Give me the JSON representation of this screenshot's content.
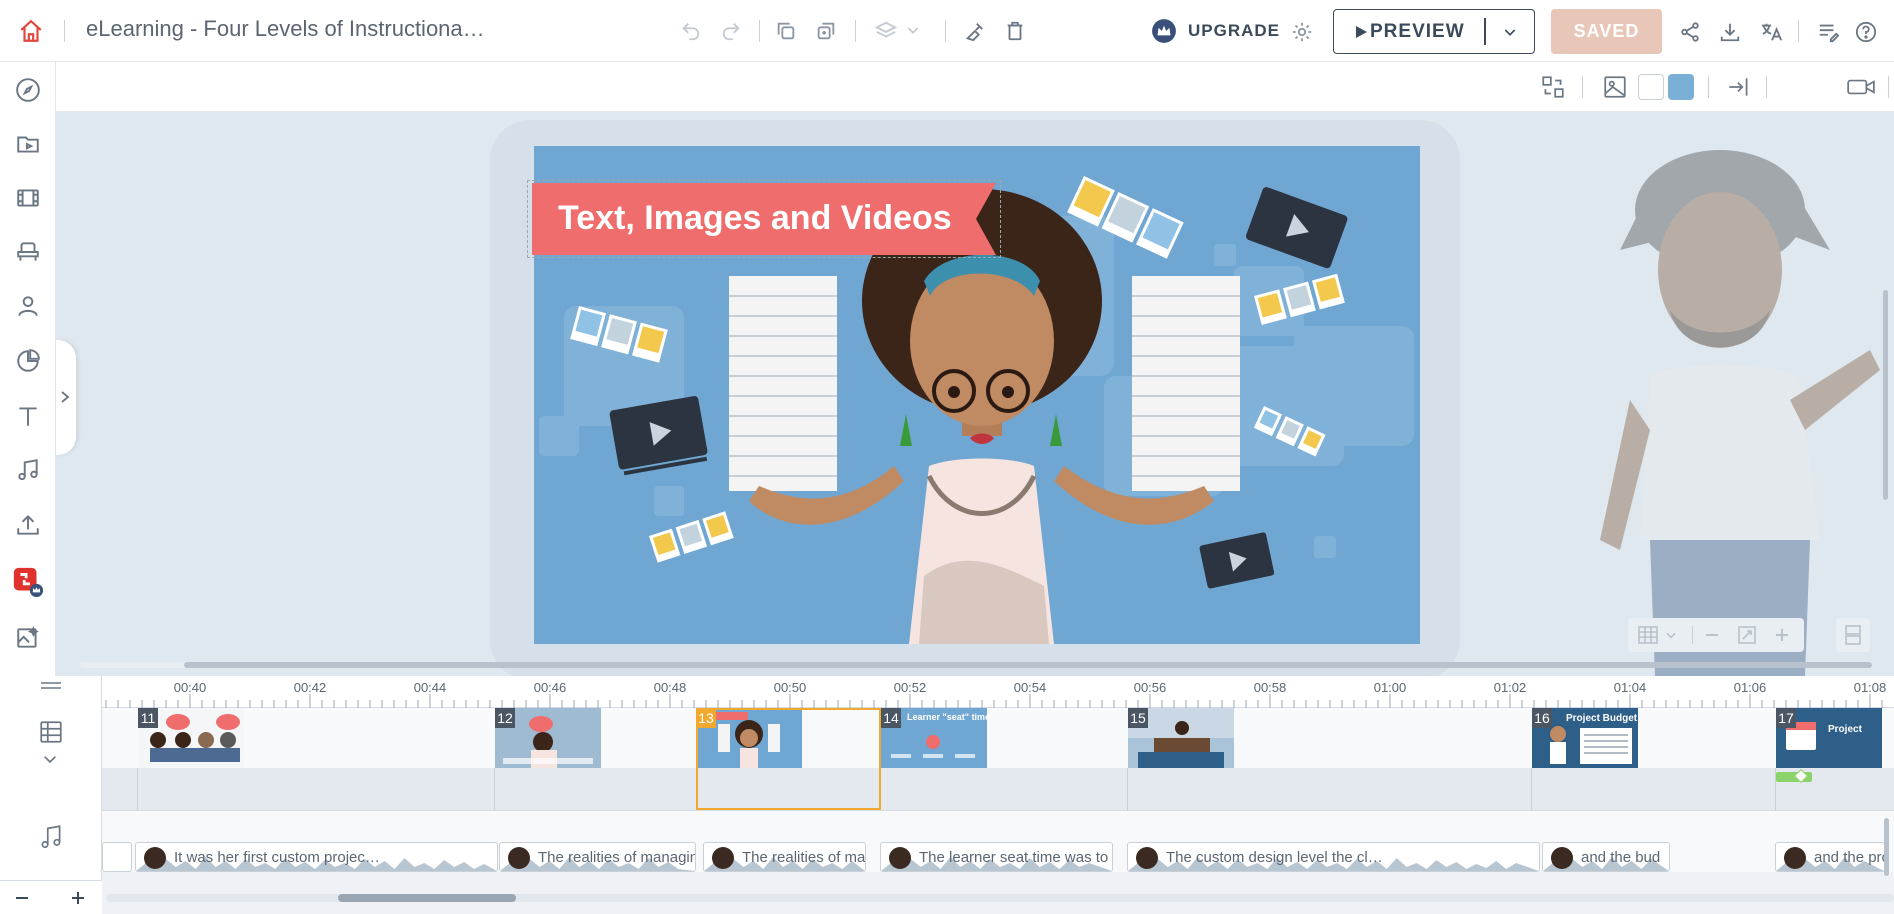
{
  "app": {
    "document_title": "eLearning - Four Levels of Instructiona…",
    "upgrade_label": "UPGRADE",
    "preview_label": "PREVIEW",
    "saved_label": "SAVED"
  },
  "topbar_icons": [
    "home-icon",
    "undo-icon",
    "redo-icon",
    "copy-icon",
    "duplicate-icon",
    "layers-icon",
    "chevron-down-icon",
    "clean-icon",
    "trash-icon",
    "crown-icon",
    "gear-icon",
    "share-icon",
    "download-icon",
    "translate-icon",
    "notes-icon",
    "help-icon"
  ],
  "sidebar_icons": [
    "compass-icon",
    "folder-icon",
    "film-icon",
    "chair-icon",
    "person-icon",
    "chart-icon",
    "text-icon",
    "music-icon",
    "upload-icon",
    "premium-icon",
    "image-edit-icon"
  ],
  "canvas_toolbar_icons": [
    "swap-icon",
    "image-icon",
    "white-swatch-icon",
    "blue-swatch-icon",
    "enter-icon",
    "video-icon",
    "gear-icon"
  ],
  "colors": {
    "accent": "#f0a92e",
    "slide_bg": "#70a7d2",
    "banner": "#ef6d6d",
    "saved_bg": "#e8c6b8",
    "swatch_white": "#ffffff",
    "swatch_blue": "#7ab0d6"
  },
  "slide": {
    "title": "Text, Images and Videos"
  },
  "timeline": {
    "ticks": [
      "00:40",
      "00:42",
      "00:44",
      "00:46",
      "00:48",
      "00:50",
      "00:52",
      "00:54",
      "00:56",
      "00:58",
      "01:00",
      "01:02",
      "01:04",
      "01:06",
      "01:08"
    ],
    "scenes": [
      {
        "number": "11",
        "thumb_text": ""
      },
      {
        "number": "12",
        "thumb_text": ""
      },
      {
        "number": "13",
        "thumb_text": ""
      },
      {
        "number": "14",
        "thumb_text": "Learner \"seat\" time"
      },
      {
        "number": "15",
        "thumb_text": ""
      },
      {
        "number": "16",
        "thumb_text": "Project Budget"
      },
      {
        "number": "17",
        "thumb_text": "Project"
      }
    ],
    "audio_clips": [
      {
        "text": "It was her first custom projec…"
      },
      {
        "text": "The realities of managin"
      },
      {
        "text": "The realities of ma"
      },
      {
        "text": "The learner seat time was to"
      },
      {
        "text": "The custom design level the cl…"
      },
      {
        "text": "and the bud"
      },
      {
        "text": "and the pro"
      }
    ]
  }
}
